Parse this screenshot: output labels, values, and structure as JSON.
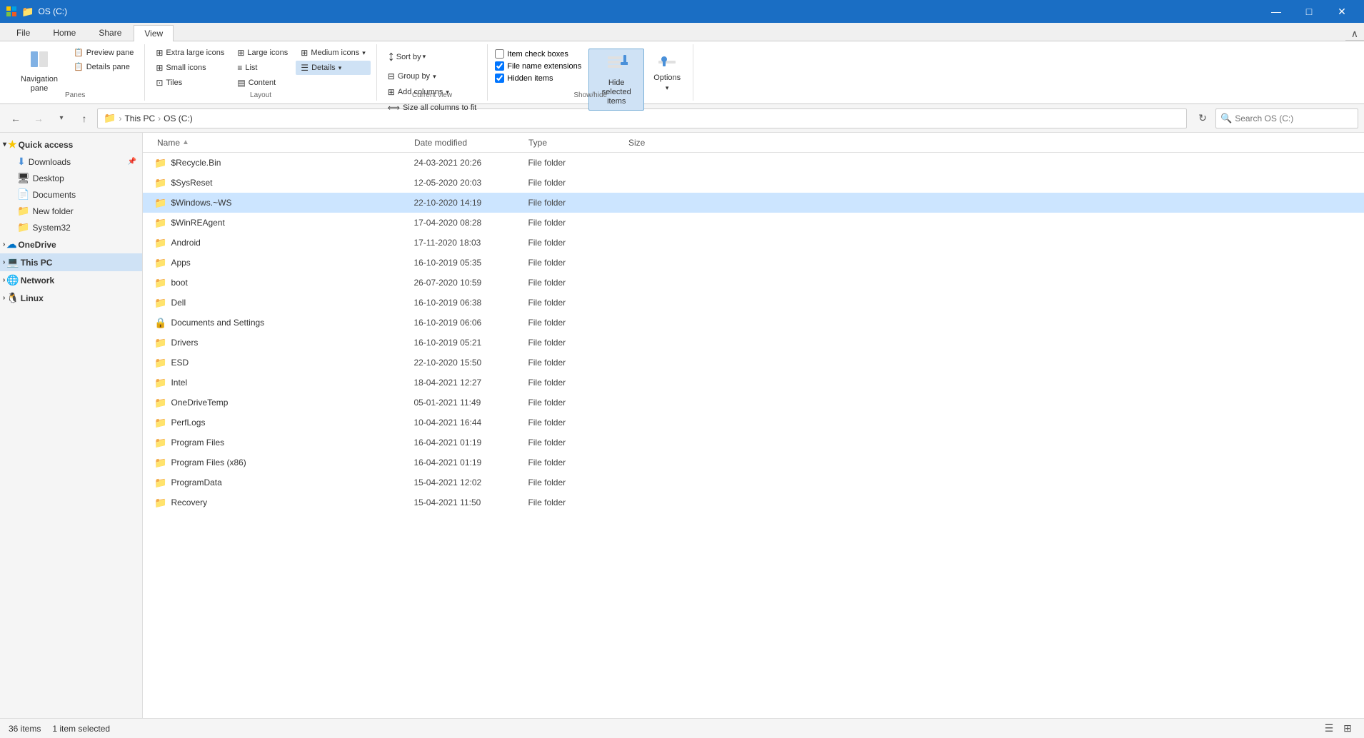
{
  "titleBar": {
    "title": "OS (C:)",
    "controls": {
      "minimize": "—",
      "maximize": "□",
      "close": "✕"
    }
  },
  "ribbonTabs": [
    {
      "id": "file",
      "label": "File",
      "active": false
    },
    {
      "id": "home",
      "label": "Home",
      "active": false
    },
    {
      "id": "share",
      "label": "Share",
      "active": false
    },
    {
      "id": "view",
      "label": "View",
      "active": true
    }
  ],
  "ribbon": {
    "panes": {
      "label": "Panes",
      "navPane": "Navigation pane",
      "previewPane": "Preview pane",
      "detailsPane": "Details pane"
    },
    "layout": {
      "label": "Layout",
      "extraLargeIcons": "Extra large icons",
      "largeIcons": "Large icons",
      "mediumIcons": "Medium icons",
      "smallIcons": "Small icons",
      "list": "List",
      "details": "Details",
      "tiles": "Tiles",
      "content": "Content"
    },
    "currentView": {
      "label": "Current view",
      "groupBy": "Group by",
      "addColumns": "Add columns",
      "sizeAllColumns": "Size all columns to fit",
      "sortBy": "Sort by"
    },
    "showHide": {
      "label": "Show/hide",
      "itemCheckboxes": "Item check boxes",
      "fileNameExtensions": "File name extensions",
      "hiddenItems": "Hidden items",
      "hideSelectedItems": "Hide selected items",
      "options": "Options"
    }
  },
  "navBar": {
    "back": "←",
    "forward": "→",
    "down": "˅",
    "up": "↑",
    "breadcrumb": [
      "This PC",
      "OS (C:)"
    ],
    "searchPlaceholder": "Search OS (C:)"
  },
  "sidebar": {
    "quickAccess": {
      "label": "Quick access",
      "items": [
        {
          "label": "Downloads",
          "icon": "⬇",
          "pinned": true
        },
        {
          "label": "Desktop",
          "icon": "🖥"
        },
        {
          "label": "Documents",
          "icon": "📄"
        },
        {
          "label": "New folder",
          "icon": "📁"
        },
        {
          "label": "System32",
          "icon": "📁"
        }
      ]
    },
    "oneDrive": {
      "label": "OneDrive",
      "icon": "☁"
    },
    "thisPc": {
      "label": "This PC",
      "active": true
    },
    "network": {
      "label": "Network",
      "icon": "🌐"
    },
    "linux": {
      "label": "Linux",
      "icon": "🐧"
    }
  },
  "columns": {
    "name": "Name",
    "dateModified": "Date modified",
    "type": "Type",
    "size": "Size"
  },
  "files": [
    {
      "name": "$Recycle.Bin",
      "date": "24-03-2021 20:26",
      "type": "File folder",
      "size": "",
      "selected": false,
      "iconType": "folder-gray"
    },
    {
      "name": "$SysReset",
      "date": "12-05-2020 20:03",
      "type": "File folder",
      "size": "",
      "selected": false,
      "iconType": "folder-gray"
    },
    {
      "name": "$Windows.~WS",
      "date": "22-10-2020 14:19",
      "type": "File folder",
      "size": "",
      "selected": true,
      "iconType": "folder-gray"
    },
    {
      "name": "$WinREAgent",
      "date": "17-04-2020 08:28",
      "type": "File folder",
      "size": "",
      "selected": false,
      "iconType": "folder-gray"
    },
    {
      "name": "Android",
      "date": "17-11-2020 18:03",
      "type": "File folder",
      "size": "",
      "selected": false,
      "iconType": "folder-yellow"
    },
    {
      "name": "Apps",
      "date": "16-10-2019 05:35",
      "type": "File folder",
      "size": "",
      "selected": false,
      "iconType": "folder-yellow"
    },
    {
      "name": "boot",
      "date": "26-07-2020 10:59",
      "type": "File folder",
      "size": "",
      "selected": false,
      "iconType": "folder-yellow"
    },
    {
      "name": "Dell",
      "date": "16-10-2019 06:38",
      "type": "File folder",
      "size": "",
      "selected": false,
      "iconType": "folder-yellow"
    },
    {
      "name": "Documents and Settings",
      "date": "16-10-2019 06:06",
      "type": "File folder",
      "size": "",
      "selected": false,
      "iconType": "folder-special"
    },
    {
      "name": "Drivers",
      "date": "16-10-2019 05:21",
      "type": "File folder",
      "size": "",
      "selected": false,
      "iconType": "folder-yellow"
    },
    {
      "name": "ESD",
      "date": "22-10-2020 15:50",
      "type": "File folder",
      "size": "",
      "selected": false,
      "iconType": "folder-yellow"
    },
    {
      "name": "Intel",
      "date": "18-04-2021 12:27",
      "type": "File folder",
      "size": "",
      "selected": false,
      "iconType": "folder-yellow"
    },
    {
      "name": "OneDriveTemp",
      "date": "05-01-2021 11:49",
      "type": "File folder",
      "size": "",
      "selected": false,
      "iconType": "folder-yellow"
    },
    {
      "name": "PerfLogs",
      "date": "10-04-2021 16:44",
      "type": "File folder",
      "size": "",
      "selected": false,
      "iconType": "folder-yellow"
    },
    {
      "name": "Program Files",
      "date": "16-04-2021 01:19",
      "type": "File folder",
      "size": "",
      "selected": false,
      "iconType": "folder-yellow"
    },
    {
      "name": "Program Files (x86)",
      "date": "16-04-2021 01:19",
      "type": "File folder",
      "size": "",
      "selected": false,
      "iconType": "folder-yellow"
    },
    {
      "name": "ProgramData",
      "date": "15-04-2021 12:02",
      "type": "File folder",
      "size": "",
      "selected": false,
      "iconType": "folder-yellow"
    },
    {
      "name": "Recovery",
      "date": "15-04-2021 11:50",
      "type": "File folder",
      "size": "",
      "selected": false,
      "iconType": "folder-yellow"
    }
  ],
  "statusBar": {
    "itemCount": "36 items",
    "selectedCount": "1 item selected",
    "viewIcons": [
      "▤",
      "▦"
    ]
  }
}
